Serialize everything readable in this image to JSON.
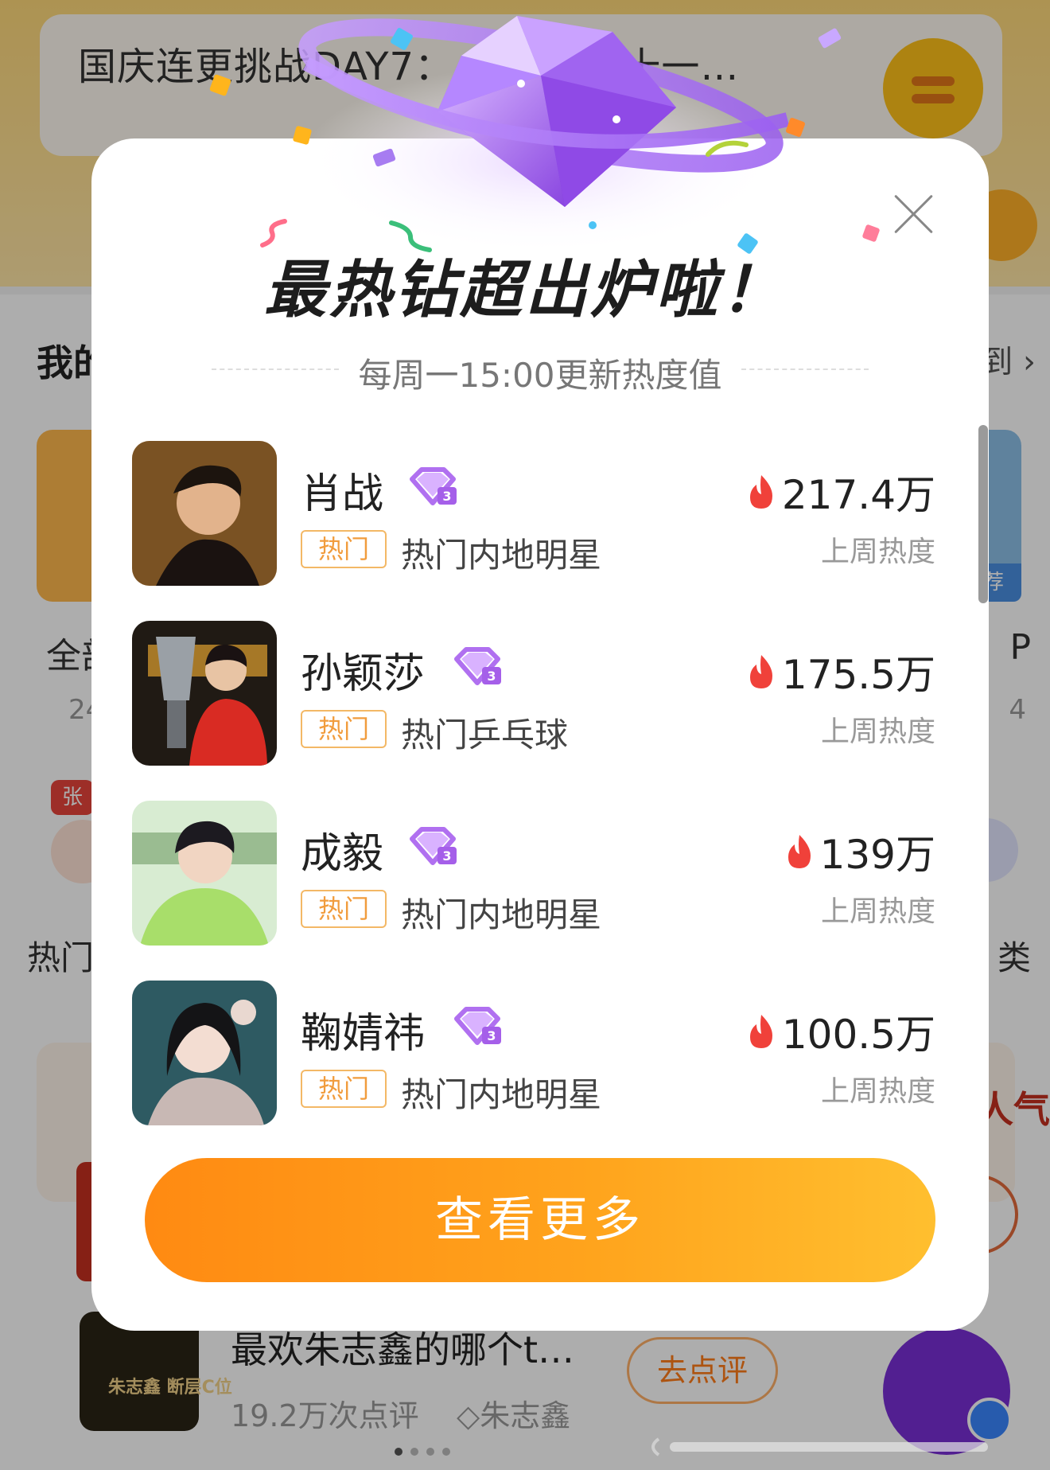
{
  "background": {
    "banner_title": "国庆连更挑战DAY7：…… 告别十一…",
    "section_title": "我的",
    "section_more": "到 ›",
    "card_tag": "荐",
    "all_label": "全部",
    "all_count": "24",
    "right_label": "P",
    "right_count": "4",
    "red_tag": "张",
    "hot_label": "热门",
    "cat_label": "类",
    "person_label": "人气",
    "thumb_text": "朱志鑫 断层C位",
    "question": "最欢朱志鑫的哪个t…",
    "review_count": "19.2万次点评",
    "diamond_tag": "朱志鑫",
    "review_button": "去点评"
  },
  "modal": {
    "title": "最热钻超出炉啦！",
    "subtitle": "每周一15:00更新热度值",
    "close_label": "×",
    "cta_label": "查看更多",
    "items": [
      {
        "name": "肖战",
        "tag": "热门",
        "category": "热门内地明星",
        "heat": "217.4万",
        "heat_label": "上周热度"
      },
      {
        "name": "孙颖莎",
        "tag": "热门",
        "category": "热门乒乓球",
        "heat": "175.5万",
        "heat_label": "上周热度"
      },
      {
        "name": "成毅",
        "tag": "热门",
        "category": "热门内地明星",
        "heat": "139万",
        "heat_label": "上周热度"
      },
      {
        "name": "鞠婧祎",
        "tag": "热门",
        "category": "热门内地明星",
        "heat": "100.5万",
        "heat_label": "上周热度"
      }
    ]
  },
  "colors": {
    "accent": "#ff8a12",
    "gem_purple": "#a86af0",
    "tag_orange": "#f19c3d",
    "flame_red": "#f0413a"
  },
  "icons": [
    "close-icon",
    "gem-icon",
    "diamond-badge-icon",
    "flame-icon"
  ]
}
